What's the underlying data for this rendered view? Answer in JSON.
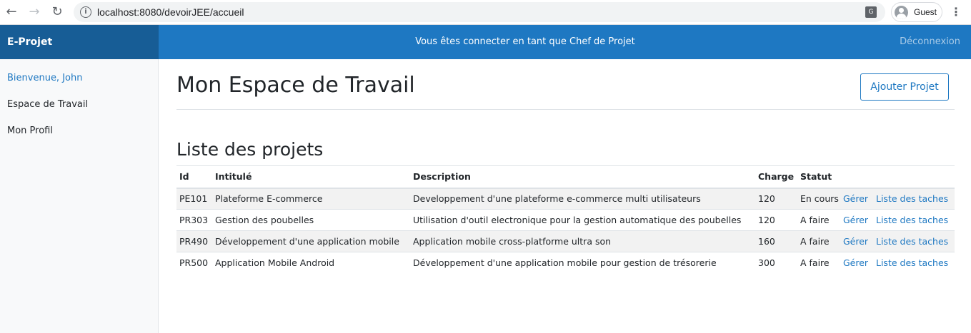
{
  "browser": {
    "url": "localhost:8080/devoirJEE/accueil",
    "profile_label": "Guest",
    "icons": [
      "back-arrow-icon",
      "forward-arrow-icon",
      "reload-icon",
      "info-icon",
      "translate-icon",
      "avatar-icon",
      "kebab-menu-icon"
    ]
  },
  "navbar": {
    "brand": "E-Projet",
    "status": "Vous êtes connecter en tant que Chef de Projet",
    "logout": "Déconnexion",
    "color": "#1e78c2",
    "brand_color": "#175d96"
  },
  "sidebar": {
    "items": [
      {
        "label": "Bienvenue, John"
      },
      {
        "label": "Espace de Travail"
      },
      {
        "label": "Mon Profil"
      }
    ]
  },
  "main": {
    "title": "Mon Espace de Travail",
    "add_button": "Ajouter Projet",
    "list_title": "Liste des projets",
    "table": {
      "headers": [
        "Id",
        "Intitulé",
        "Description",
        "Charge",
        "Statut"
      ],
      "rows": [
        {
          "id": "PE101",
          "title": "Plateforme E-commerce",
          "description": "Developpement d'une plateforme e-commerce multi utilisateurs",
          "charge": "120",
          "status": "En cours",
          "manage": "Gérer",
          "tasks": "Liste des taches"
        },
        {
          "id": "PR303",
          "title": "Gestion des poubelles",
          "description": "Utilisation d'outil electronique pour la gestion automatique des poubelles",
          "charge": "120",
          "status": "A faire",
          "manage": "Gérer",
          "tasks": "Liste des taches"
        },
        {
          "id": "PR490",
          "title": "Développement d'une application mobile",
          "description": "Application mobile cross-platforme ultra son",
          "charge": "160",
          "status": "A faire",
          "manage": "Gérer",
          "tasks": "Liste des taches"
        },
        {
          "id": "PR500",
          "title": "Application Mobile Android",
          "description": "Développement d'une application mobile pour gestion de trésorerie",
          "charge": "300",
          "status": "A faire",
          "manage": "Gérer",
          "tasks": "Liste des taches"
        }
      ]
    }
  }
}
